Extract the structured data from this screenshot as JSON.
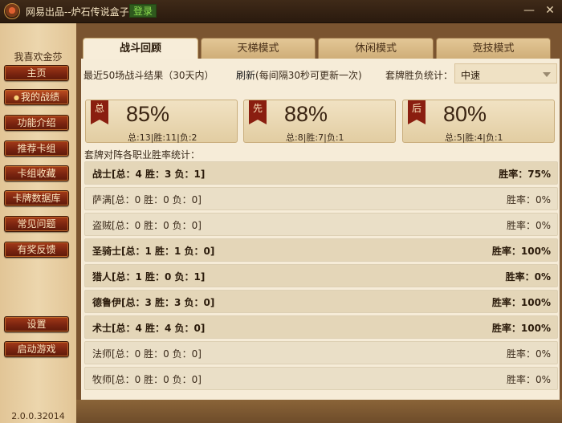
{
  "window": {
    "title": "网易出品--炉石传说盒子",
    "login_label": "登录",
    "minimize_icon": "minimize-icon",
    "close_icon": "close-icon"
  },
  "sidebar": {
    "greeting": "我喜欢金莎",
    "items": [
      {
        "label": "主页"
      },
      {
        "label": "我的战绩",
        "active": true
      },
      {
        "label": "功能介绍"
      },
      {
        "label": "推荐卡组"
      },
      {
        "label": "卡组收藏"
      },
      {
        "label": "卡牌数据库"
      },
      {
        "label": "常见问题"
      },
      {
        "label": "有奖反馈"
      }
    ],
    "bottom_items": [
      {
        "label": "设置"
      },
      {
        "label": "启动游戏"
      }
    ],
    "version": "2.0.0.32014"
  },
  "tabs": [
    {
      "label": "战斗回顾",
      "active": true
    },
    {
      "label": "天梯模式"
    },
    {
      "label": "休闲模式"
    },
    {
      "label": "竞技模式"
    }
  ],
  "status": {
    "recent_text": "最近50场战斗结果（30天内）",
    "refresh_link": "刷新",
    "refresh_note": "(每间隔30秒可更新一次)",
    "stat_label": "套牌胜负统计：",
    "deck_select_value": "中速"
  },
  "summary_cards": [
    {
      "badge": "总",
      "percent": "85%",
      "detail": "总:13|胜:11|负:2"
    },
    {
      "badge": "先",
      "percent": "88%",
      "detail": "总:8|胜:7|负:1"
    },
    {
      "badge": "后",
      "percent": "80%",
      "detail": "总:5|胜:4|负:1"
    }
  ],
  "class_section_title": "套牌对阵各职业胜率统计：",
  "class_rows": [
    {
      "text": "战士[总：4 胜：3 负：1]",
      "rate": "胜率：75%",
      "highlight": true
    },
    {
      "text": "萨满[总：0 胜：0 负：0]",
      "rate": "胜率：0%",
      "highlight": false
    },
    {
      "text": "盗贼[总：0 胜：0 负：0]",
      "rate": "胜率：0%",
      "highlight": false
    },
    {
      "text": "圣骑士[总：1 胜：1 负：0]",
      "rate": "胜率：100%",
      "highlight": true
    },
    {
      "text": "猎人[总：1 胜：0 负：1]",
      "rate": "胜率：0%",
      "highlight": true
    },
    {
      "text": "德鲁伊[总：3 胜：3 负：0]",
      "rate": "胜率：100%",
      "highlight": true
    },
    {
      "text": "术士[总：4 胜：4 负：0]",
      "rate": "胜率：100%",
      "highlight": true
    },
    {
      "text": "法师[总：0 胜：0 负：0]",
      "rate": "胜率：0%",
      "highlight": false
    },
    {
      "text": "牧师[总：0 胜：0 负：0]",
      "rate": "胜率：0%",
      "highlight": false
    }
  ]
}
